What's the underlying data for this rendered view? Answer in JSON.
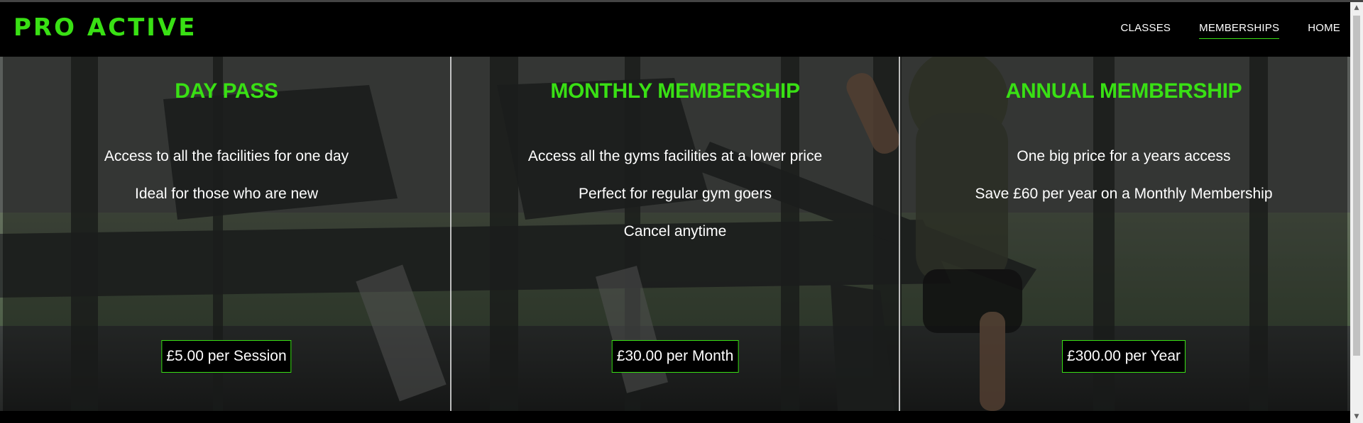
{
  "site": {
    "logo": "PRO ACTIVE",
    "accent_color": "#39e014"
  },
  "nav": {
    "items": [
      {
        "label": "CLASSES",
        "active": false
      },
      {
        "label": "MEMBERSHIPS",
        "active": true
      },
      {
        "label": "HOME",
        "active": false
      }
    ]
  },
  "memberships": [
    {
      "title": "DAY PASS",
      "features": [
        "Access to all the facilities for one day",
        "Ideal for those who are new"
      ],
      "price": "£5.00 per Session"
    },
    {
      "title": "MONTHLY MEMBERSHIP",
      "features": [
        "Access all the gyms facilities at a lower price",
        "Perfect for regular gym goers",
        "Cancel anytime"
      ],
      "price": "£30.00 per Month"
    },
    {
      "title": "ANNUAL MEMBERSHIP",
      "features": [
        "One big price for a years access",
        "Save £60 per year on a Monthly Membership"
      ],
      "price": "£300.00 per Year"
    }
  ],
  "icons": {
    "scroll_up": "scroll-up-arrow-icon",
    "scroll_down": "scroll-down-arrow-icon"
  }
}
